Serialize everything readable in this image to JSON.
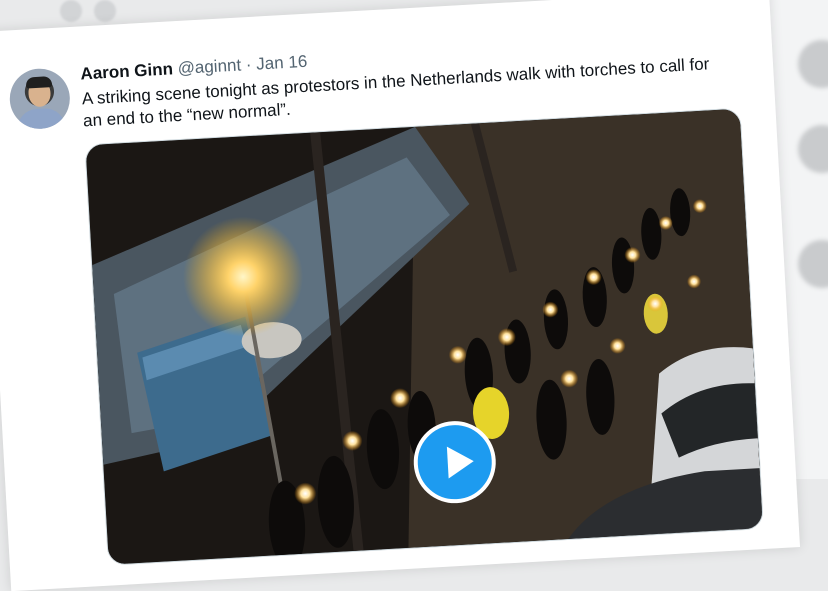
{
  "tweet": {
    "author_name": "Aaron Ginn",
    "handle": "@aginnt",
    "separator": "·",
    "date": "Jan 16",
    "text": "A striking scene tonight as protestors in the Netherlands walk with torches to call for an end to the “new normal”."
  },
  "media": {
    "type": "video",
    "play_icon": "play-icon",
    "accent_color": "#1d9bf0"
  }
}
